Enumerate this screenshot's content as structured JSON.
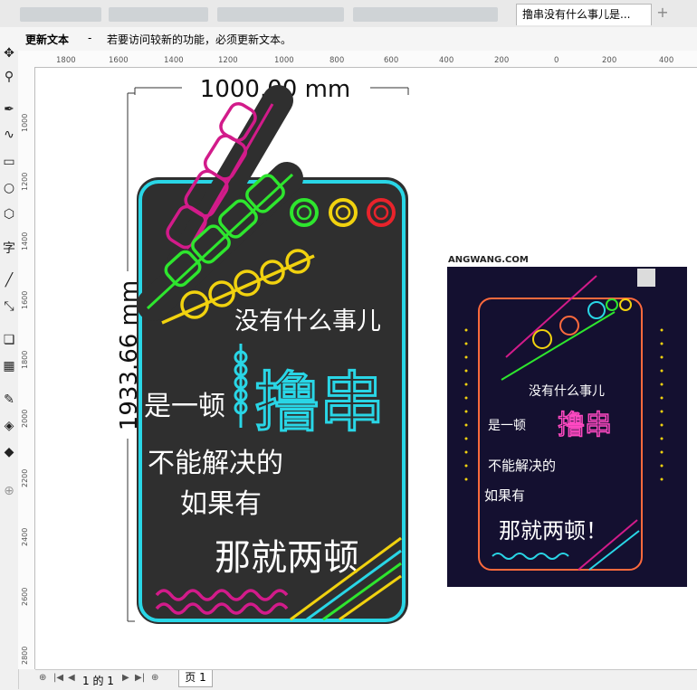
{
  "tabs": {
    "active_document": "撸串没有什么事儿是...",
    "add_symbol": "+"
  },
  "notice": {
    "title": "更新文本",
    "separator": "-",
    "message": "若要访问较新的功能，必须更新文本。"
  },
  "ruler": {
    "top_labels": [
      "1800",
      "1600",
      "1400",
      "1200",
      "1000",
      "800",
      "600",
      "400",
      "200",
      "0",
      "200",
      "400"
    ],
    "left_labels": [
      "1000",
      "1200",
      "1400",
      "1600",
      "1800",
      "2000",
      "2200",
      "2400",
      "2600",
      "2800"
    ]
  },
  "dimensions": {
    "width_label": "1000.00 mm",
    "height_label": "1933.66 mm"
  },
  "design": {
    "line1": "没有什么事儿",
    "line2_prefix": "是一顿",
    "line2_big": "撸串",
    "line3": "不能解决的",
    "line4": "如果有",
    "line5": "那就两顿"
  },
  "reference": {
    "site_text": "ANGWANG.COM",
    "exclaim": "那就两顿！"
  },
  "pagebar": {
    "page_of": "1 的 1",
    "page_tab": "页 1"
  },
  "colors": {
    "board": "#2f2f2f",
    "frame": "#29d6e6",
    "skewer_pink": "#d21b8a",
    "skewer_green": "#2ee62e",
    "ring_yellow": "#f1d20f",
    "ring_red": "#e8232b"
  }
}
